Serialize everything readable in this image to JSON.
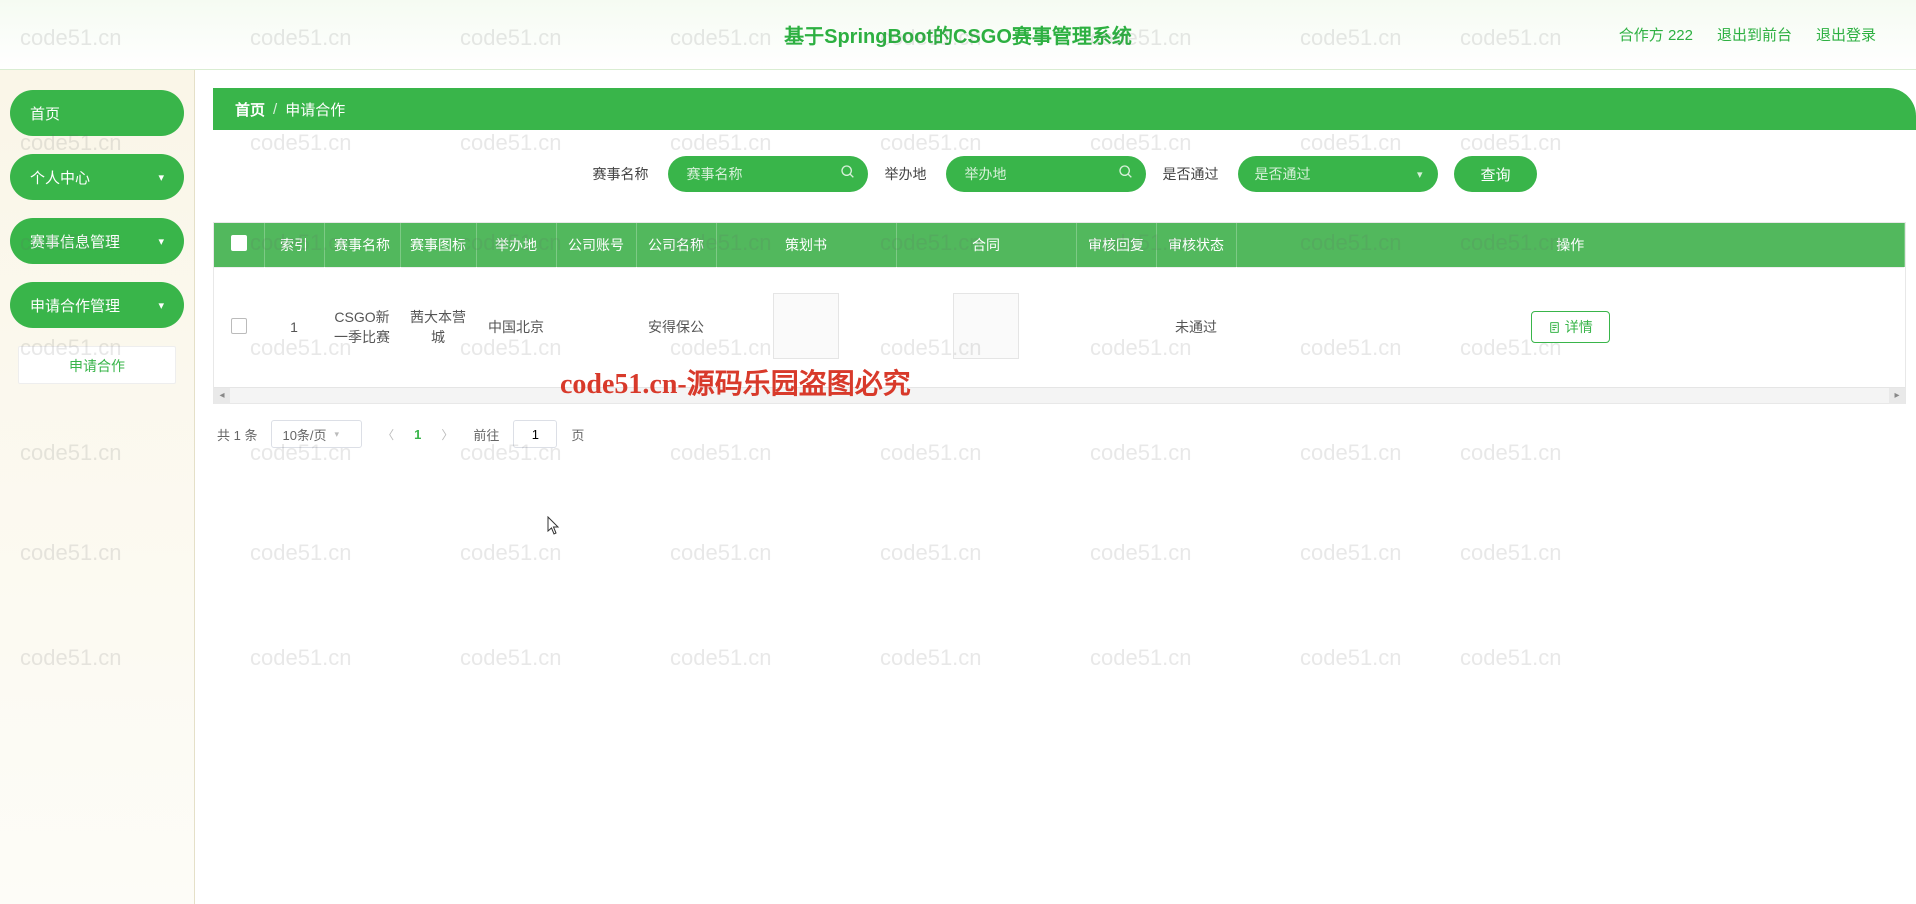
{
  "header": {
    "title": "基于SpringBoot的CSGO赛事管理系统",
    "partner_label": "合作方",
    "partner_value": "222",
    "to_front": "退出到前台",
    "logout": "退出登录"
  },
  "sidebar": {
    "items": [
      {
        "label": "首页",
        "expandable": false
      },
      {
        "label": "个人中心",
        "expandable": true
      },
      {
        "label": "赛事信息管理",
        "expandable": true
      },
      {
        "label": "申请合作管理",
        "expandable": true
      }
    ],
    "submenu": {
      "label": "申请合作"
    }
  },
  "breadcrumb": {
    "home": "首页",
    "current": "申请合作"
  },
  "search": {
    "name_label": "赛事名称",
    "name_placeholder": "赛事名称",
    "loc_label": "举办地",
    "loc_placeholder": "举办地",
    "pass_label": "是否通过",
    "pass_placeholder": "是否通过",
    "query_btn": "查询"
  },
  "table": {
    "headers": [
      "索引",
      "赛事名称",
      "赛事图标",
      "举办地",
      "公司账号",
      "公司名称",
      "策划书",
      "合同",
      "审核回复",
      "审核状态",
      "操作"
    ],
    "rows": [
      {
        "index": "1",
        "name": "CSGO新一季比赛",
        "icon": "茜大本营城",
        "location": "中国北京",
        "account": "",
        "company": "安得保公",
        "plan": "",
        "contract": "",
        "reply": "",
        "status": "未通过",
        "action": "详情"
      }
    ]
  },
  "pagination": {
    "total_text": "共 1 条",
    "page_size": "10条/页",
    "current": "1",
    "goto_label": "前往",
    "goto_value": "1",
    "goto_suffix": "页"
  },
  "watermark": {
    "gray": "code51.cn",
    "red": "code51.cn-源码乐园盗图必究"
  }
}
